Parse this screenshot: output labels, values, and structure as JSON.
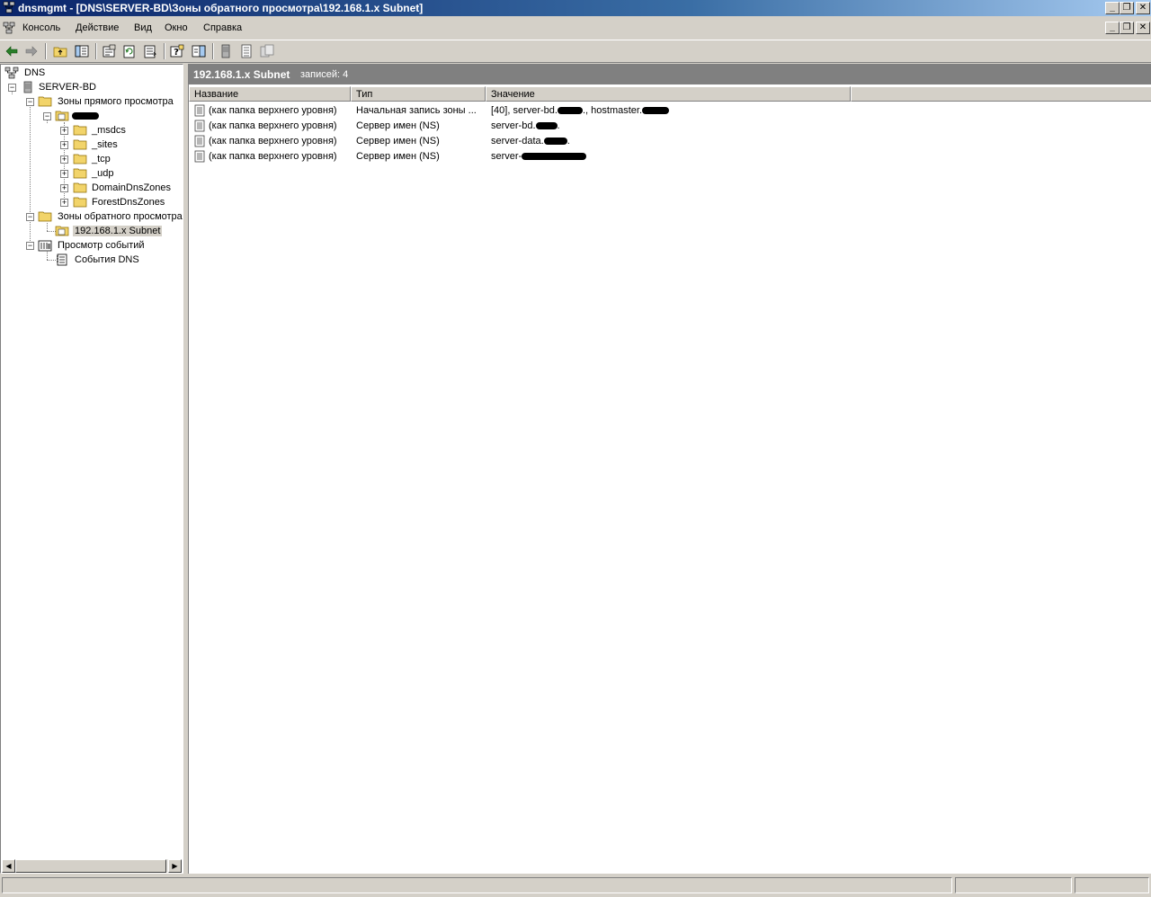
{
  "window": {
    "title": "dnsmgmt - [DNS\\SERVER-BD\\Зоны обратного просмотра\\192.168.1.x Subnet]",
    "caption_buttons": [
      "_",
      "❐",
      "✕"
    ],
    "inner_buttons": [
      "_",
      "❐",
      "✕"
    ]
  },
  "menu": {
    "items": [
      {
        "label": "Консоль"
      },
      {
        "label": "Действие"
      },
      {
        "label": "Вид"
      },
      {
        "label": "Окно"
      },
      {
        "label": "Справка"
      }
    ]
  },
  "toolbar": {
    "buttons": [
      "back-icon",
      "forward-icon",
      "up-folder-icon",
      "show-hide-tree-icon",
      "properties-icon",
      "refresh-icon",
      "export-list-icon",
      "help-icon",
      "action-pane-icon",
      "server-icon",
      "record-icon",
      "copy-icon"
    ]
  },
  "tree": {
    "nodes": [
      {
        "label": "DNS"
      },
      {
        "label": "SERVER-BD"
      },
      {
        "label": "Зоны прямого просмотра"
      },
      {
        "label": ""
      },
      {
        "label": "_msdcs"
      },
      {
        "label": "_sites"
      },
      {
        "label": "_tcp"
      },
      {
        "label": "_udp"
      },
      {
        "label": "DomainDnsZones"
      },
      {
        "label": "ForestDnsZones"
      },
      {
        "label": "Зоны обратного просмотра"
      },
      {
        "label": "192.168.1.x Subnet"
      },
      {
        "label": "Просмотр событий"
      },
      {
        "label": "События DNS"
      }
    ]
  },
  "details": {
    "title": "192.168.1.x Subnet",
    "count_text": "записей: 4",
    "columns": [
      "Название",
      "Тип",
      "Значение"
    ],
    "rows": [
      {
        "name": "(как папка верхнего уровня)",
        "type": "Начальная запись зоны ...",
        "value_a": "[40], server-bd.",
        "value_b": "., hostmaster."
      },
      {
        "name": "(как папка верхнего уровня)",
        "type": "Сервер имен (NS)",
        "value_a": "server-bd.",
        "value_b": "."
      },
      {
        "name": "(как папка верхнего уровня)",
        "type": "Сервер имен (NS)",
        "value_a": "server-data.",
        "value_b": "."
      },
      {
        "name": "(как папка верхнего уровня)",
        "type": "Сервер имен (NS)",
        "value_a": "server-",
        "value_b": ""
      }
    ]
  }
}
